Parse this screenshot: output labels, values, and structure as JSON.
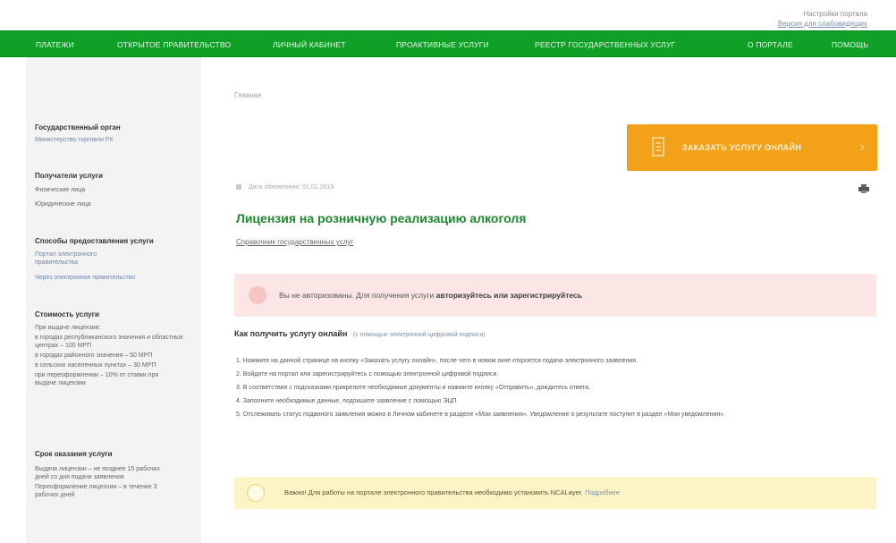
{
  "top_links": {
    "line1": "Настройки портала",
    "line2": "Версия для слабовидящих"
  },
  "nav": {
    "items": [
      "Платежи",
      "Открытое правительство",
      "Личный кабинет",
      "Проактивные услуги",
      "Реестр государственных услуг",
      "О портале",
      "Помощь"
    ]
  },
  "sidebar": {
    "g1_head": "Государственный орган",
    "g1_link": "Министерство торговли РК",
    "g2_head": "Получатели услуги",
    "g2_a": "Физические лица",
    "g2_b": "Юридические лица",
    "g3_head": "Способы предоставления услуги",
    "g3_a": "Портал электронного правительства",
    "g3_b": "Через электронное правительство",
    "g4_head": "Стоимость услуги",
    "g4_a": "При выдаче лицензии:",
    "g4_b": "в городах республиканского значения и областных центрах – 100 МРП",
    "g4_c": "в городах районного значения – 50 МРП",
    "g4_d": "в сельских населенных пунктах – 30 МРП",
    "g4_e": "при переоформлении – 10% от ставки при выдаче лицензии",
    "g5_head": "Срок оказания услуги",
    "g5_a": "Выдача лицензии – не позднее 15 рабочих дней со дня подачи заявления",
    "g5_b": "Переоформление лицензии – в течение 3 рабочих дней"
  },
  "breadcrumb": "Главная",
  "order_button": "Заказать услугу онлайн",
  "meta": "Дата обновления: 01.01.2019",
  "title": "Лицензия на розничную реализацию алкоголя",
  "dept_link": "Справочник государственных услуг",
  "auth": {
    "prefix": "Вы не авторизованы. Для получения услуги",
    "action": "авторизуйтесь или зарегистрируйтесь"
  },
  "how": {
    "heading": "Как получить услугу онлайн",
    "sub": "(с помощью электронной цифровой подписи)"
  },
  "steps": [
    "1. Нажмите на данной странице на кнопку «Заказать услугу онлайн», после чего в новом окне откроется подача электронного заявления.",
    "2. Войдите на портал или зарегистрируйтесь с помощью электронной цифровой подписи.",
    "3. В соответствии с подсказками прикрепите необходимые документы и нажмите кнопку «Отправить», дождитесь ответа.",
    "4. Заполните необходимые данные, подпишите заявление с помощью ЭЦП.",
    "5. Отслеживать статус поданного заявления можно в Личном кабинете в разделе «Мои заявления». Уведомление о результате поступит в раздел «Мои уведомления»."
  ],
  "note": {
    "text": "Важно! Для работы на портале электронного правительства необходимо установить NCALayer.",
    "link": "Подробнее"
  },
  "colors": {
    "nav_green": "#10a027",
    "title_green": "#1c8a2e",
    "order_orange": "#f3a118",
    "auth_pink": "#fbe5e5",
    "note_yellow": "#fdf4c6"
  }
}
